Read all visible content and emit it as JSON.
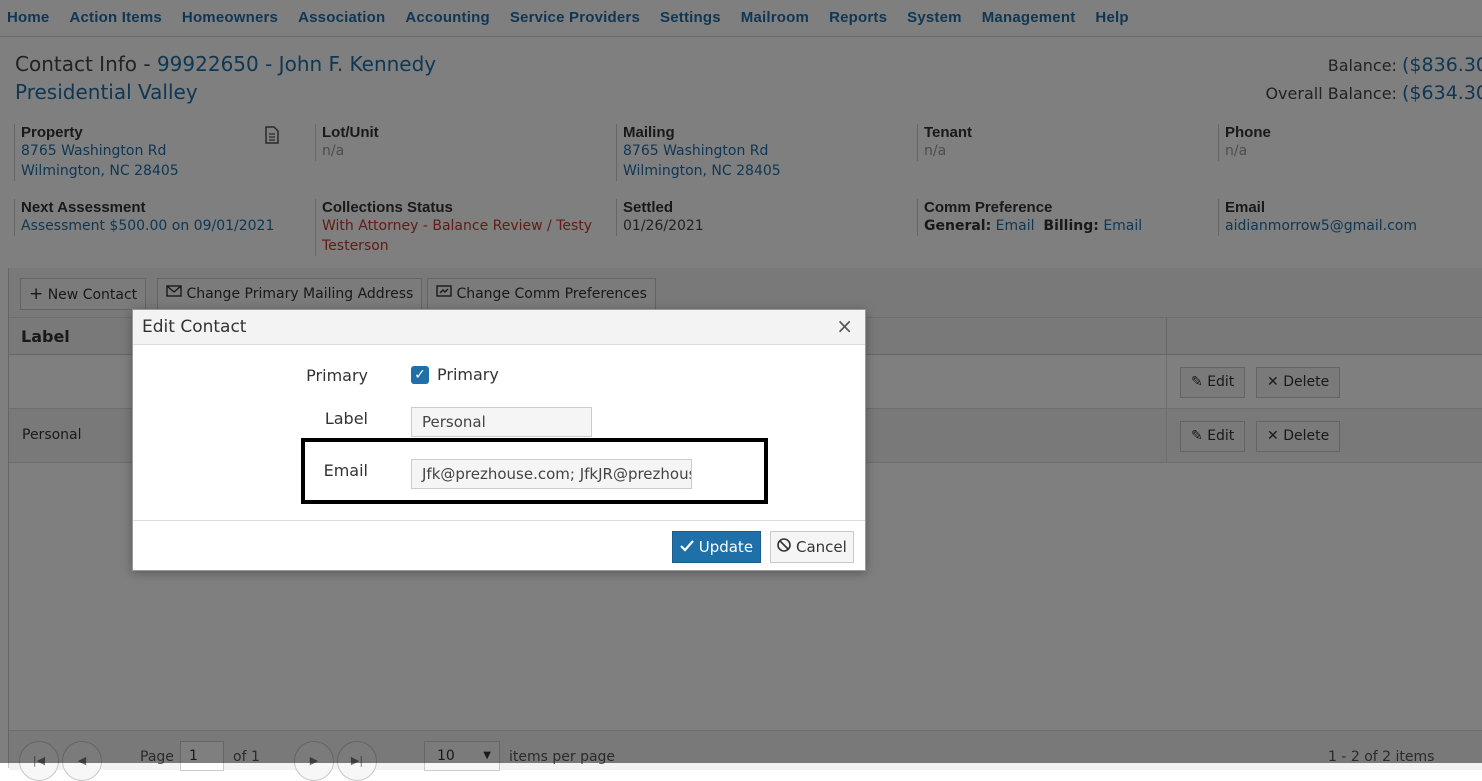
{
  "nav": {
    "items": [
      "Home",
      "Action Items",
      "Homeowners",
      "Association",
      "Accounting",
      "Service Providers",
      "Settings",
      "Mailroom",
      "Reports",
      "System",
      "Management",
      "Help"
    ]
  },
  "header": {
    "title_prefix": "Contact Info - ",
    "title_link": "99922650 - John F. Kennedy",
    "association": "Presidential Valley",
    "balance_label": "Balance: ",
    "balance_value": "($836.30",
    "overall_label": "Overall Balance: ",
    "overall_value": "($634.30"
  },
  "info": {
    "property": {
      "label": "Property",
      "line1": "8765 Washington Rd",
      "line2": "Wilmington, NC 28405"
    },
    "lot": {
      "label": "Lot/Unit",
      "value": "n/a"
    },
    "mailing": {
      "label": "Mailing",
      "line1": "8765 Washington Rd",
      "line2": "Wilmington, NC 28405"
    },
    "tenant": {
      "label": "Tenant",
      "value": "n/a"
    },
    "phone": {
      "label": "Phone",
      "value": "n/a"
    },
    "next_assessment": {
      "label": "Next Assessment",
      "value": "Assessment $500.00 on 09/01/2021"
    },
    "collections": {
      "label": "Collections Status",
      "line1": "With Attorney - Balance Review  / Testy",
      "line2": "Testerson"
    },
    "settled": {
      "label": "Settled",
      "value": "01/26/2021"
    },
    "comm": {
      "label": "Comm Preference",
      "general_label": "General:",
      "general_value": "Email",
      "billing_label": "Billing:",
      "billing_value": "Email"
    },
    "email": {
      "label": "Email",
      "value": "aidianmorrow5@gmail.com"
    }
  },
  "toolbar": {
    "new_contact": "New Contact",
    "change_mailing": "Change Primary Mailing Address",
    "change_comm": "Change Comm Preferences"
  },
  "grid": {
    "col_label": "Label",
    "rows": [
      {
        "label": "",
        "edit": "Edit",
        "delete": "Delete"
      },
      {
        "label": "Personal",
        "edit": "Edit",
        "delete": "Delete"
      }
    ]
  },
  "pager": {
    "page_label": "Page",
    "page_value": "1",
    "of_label": "of 1",
    "page_size": "10",
    "items_per_page": "items per page",
    "summary": "1 - 2 of 2 items"
  },
  "modal": {
    "title": "Edit Contact",
    "primary_label": "Primary",
    "primary_checkbox_label": "Primary",
    "label_label": "Label",
    "label_value": "Personal",
    "email_label": "Email",
    "email_value": "Jfk@prezhouse.com; JfkJR@prezhouse",
    "update_label": "Update",
    "cancel_label": "Cancel"
  }
}
